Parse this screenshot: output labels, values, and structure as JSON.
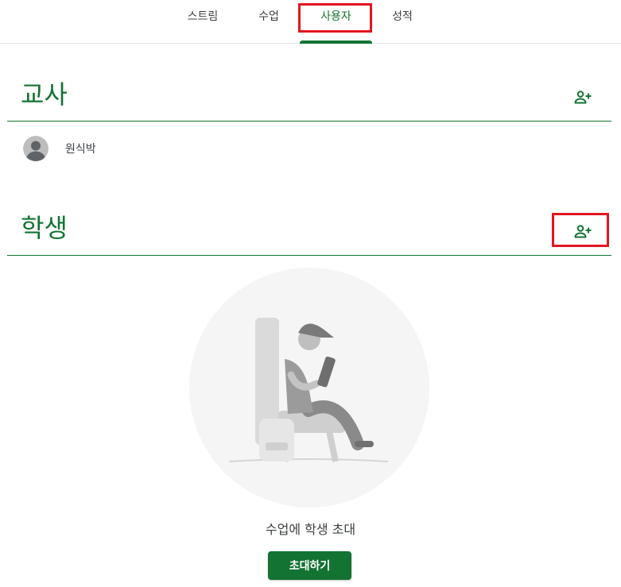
{
  "tabs": [
    {
      "label": "스트림"
    },
    {
      "label": "수업"
    },
    {
      "label": "사용자"
    },
    {
      "label": "성적"
    }
  ],
  "teachers": {
    "title": "교사",
    "add_icon": "person-add-icon",
    "list": [
      {
        "name": "원식박",
        "avatar": "default-avatar-icon"
      }
    ]
  },
  "students": {
    "title": "학생",
    "add_icon": "person-add-icon",
    "empty_message": "수업에 학생 초대",
    "invite_button": "초대하기"
  },
  "colors": {
    "accent": "#137333",
    "highlight": "#e3161f",
    "rule": "#137333"
  }
}
